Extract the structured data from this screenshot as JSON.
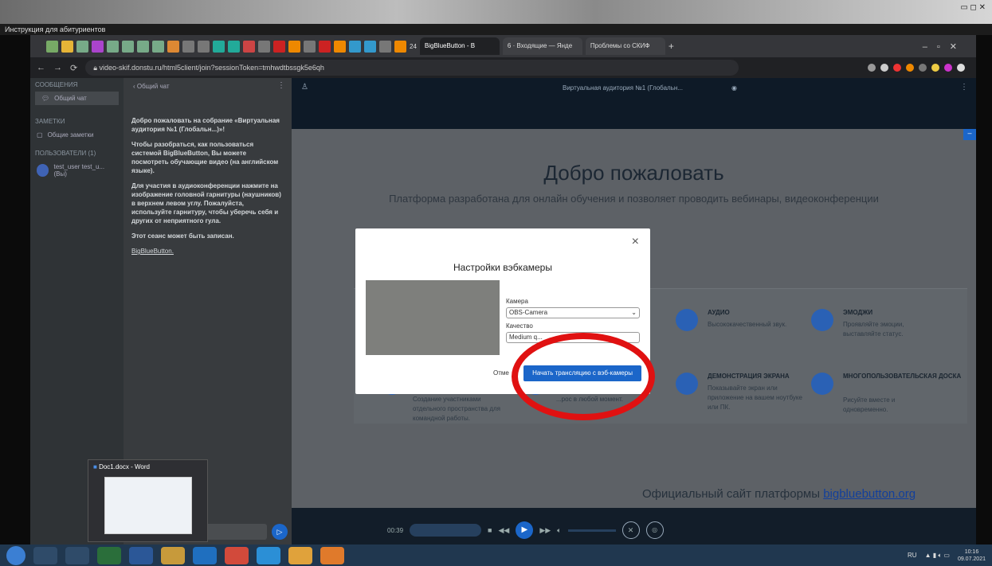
{
  "outer": {
    "window_title": "Инструкция для абитуриентов"
  },
  "browser": {
    "tabs": [
      {
        "label": "BigBlueButton - В",
        "active": true
      },
      {
        "label": "6 · Входящие — Янде",
        "active": false
      },
      {
        "label": "Проблемы со СКИФ",
        "active": false
      }
    ],
    "tab_count_badge": "24",
    "url": "video-skif.donstu.ru/html5client/join?sessionToken=tmhwdtbssgk5e6qh"
  },
  "leftnav": {
    "messages_header": "СООБЩЕНИЯ",
    "public_chat": "Общий чат",
    "notes_header": "ЗАМЕТКИ",
    "shared_notes": "Общие заметки",
    "users_header": "ПОЛЬЗОВАТЕЛИ (1)",
    "user_name": "test_user test_u... (Вы)"
  },
  "chat": {
    "header": "Общий чат",
    "welcome": "Добро пожаловать на собрание «Виртуальная аудитория №1 (Глобальн...)»!",
    "para1": "Чтобы разобраться, как пользоваться системой BigBlueButton, Вы можете посмотреть обучающие видео (на английском языке).",
    "para2": "Для участия в аудиоконференции нажмите на изображение головной гарнитуры (наушников) в верхнем левом углу. Пожалуйста, используйте гарнитуру, чтобы уберечь себя и других от неприятного гула.",
    "para3": "Этот сеанс может быть записан.",
    "link": "BigBlueButton.",
    "input_placeholder": "Общий чат"
  },
  "main": {
    "room_title": "Виртуальная аудитория №1 (Глобальн...",
    "welcome_title": "Добро пожаловать",
    "welcome_sub": "Платформа разработана для онлайн обучения и позволяет проводить вебинары, видеоконференции",
    "features": [
      {
        "title": "АУДИО",
        "desc": "Высококачественный звук."
      },
      {
        "title": "ЭМОДЖИ",
        "desc": "Проявляйте эмоции, выставляйте статус."
      },
      {
        "title": "ДЕМОНСТРАЦИЯ ЭКРАНА",
        "desc": "Показывайте экран или приложение на вашем ноутбуке или ПК."
      },
      {
        "title": "МНОГОПОЛЬЗОВАТЕЛЬСКАЯ ДОСКА",
        "desc": "Рисуйте вместе и одновременно."
      }
    ],
    "breakout_desc": "Создание участниками отдельного пространства для командной работы.",
    "poll_desc": "...рос в любой момент.",
    "footer_text": "Официальный сайт платформы ",
    "footer_link": "bigbluebutton.org",
    "video_time": "00:39"
  },
  "modal": {
    "title": "Настройки вэбкамеры",
    "camera_label": "Камера",
    "camera_value": "OBS-Camera",
    "quality_label": "Качество",
    "quality_value": "Medium q...",
    "cancel_label": "Отме",
    "start_label": "Начать трансляцию с вэб-камеры",
    "close_label": "×"
  },
  "taskbar": {
    "thumb_title": "Doc1.docx - Word",
    "lang": "RU",
    "time": "10:16",
    "date": "09.07.2021"
  },
  "colors": {
    "accent": "#1b66c9",
    "ring": "#e01111"
  }
}
